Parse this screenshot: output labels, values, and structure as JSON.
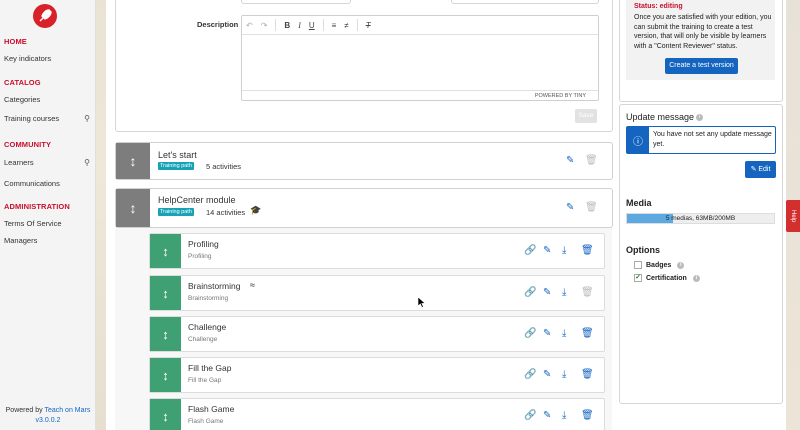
{
  "sidebar": {
    "sections": [
      {
        "title": "HOME",
        "items": [
          {
            "label": "Key indicators",
            "search": false
          }
        ]
      },
      {
        "title": "CATALOG",
        "items": [
          {
            "label": "Categories",
            "search": false
          },
          {
            "label": "Training courses",
            "search": true
          }
        ]
      },
      {
        "title": "COMMUNITY",
        "items": [
          {
            "label": "Learners",
            "search": true
          },
          {
            "label": "Communications",
            "search": false
          }
        ]
      },
      {
        "title": "ADMINISTRATION",
        "items": [
          {
            "label": "Terms Of Service",
            "search": false
          },
          {
            "label": "Managers",
            "search": false
          }
        ]
      }
    ],
    "powered_prefix": "Powered by ",
    "powered_brand": "Teach on Mars",
    "version": "v3.0.0.2"
  },
  "editor": {
    "description_label": "Description",
    "powered_by": "POWERED BY TINY",
    "save_label": "Save"
  },
  "modules": [
    {
      "title": "Let's start",
      "badge": "Training path",
      "activities": "5 activities"
    },
    {
      "title": "HelpCenter module",
      "badge": "Training path",
      "activities": "14 activities"
    }
  ],
  "activities": [
    {
      "title": "Profiling",
      "subtitle": "Profiling"
    },
    {
      "title": "Brainstorming",
      "subtitle": "Brainstorming"
    },
    {
      "title": "Challenge",
      "subtitle": "Challenge"
    },
    {
      "title": "Fill the Gap",
      "subtitle": "Fill the Gap"
    },
    {
      "title": "Flash Game",
      "subtitle": "Flash Game"
    }
  ],
  "status": {
    "title": "Status: editing",
    "text": "Once you are satisfied with your edition, you can submit the training to create a test version, that will only be visible by learners with a \"Content Reviewer\" status.",
    "button": "Create a test version"
  },
  "update_message": {
    "heading": "Update message",
    "notice": "You have not set any update message yet.",
    "edit_label": "Edit"
  },
  "media": {
    "heading": "Media",
    "usage_text": "5 medias, 63MB/200MB",
    "fraction": 0.315
  },
  "options": {
    "heading": "Options",
    "items": [
      {
        "label": "Badges",
        "checked": false
      },
      {
        "label": "Certification",
        "checked": true
      }
    ]
  },
  "help_tab": "Help",
  "colors": {
    "brand_red": "#c8102e",
    "primary_blue": "#1565c0",
    "training_badge": "#17a2b8",
    "activity_green": "#3fa173"
  }
}
